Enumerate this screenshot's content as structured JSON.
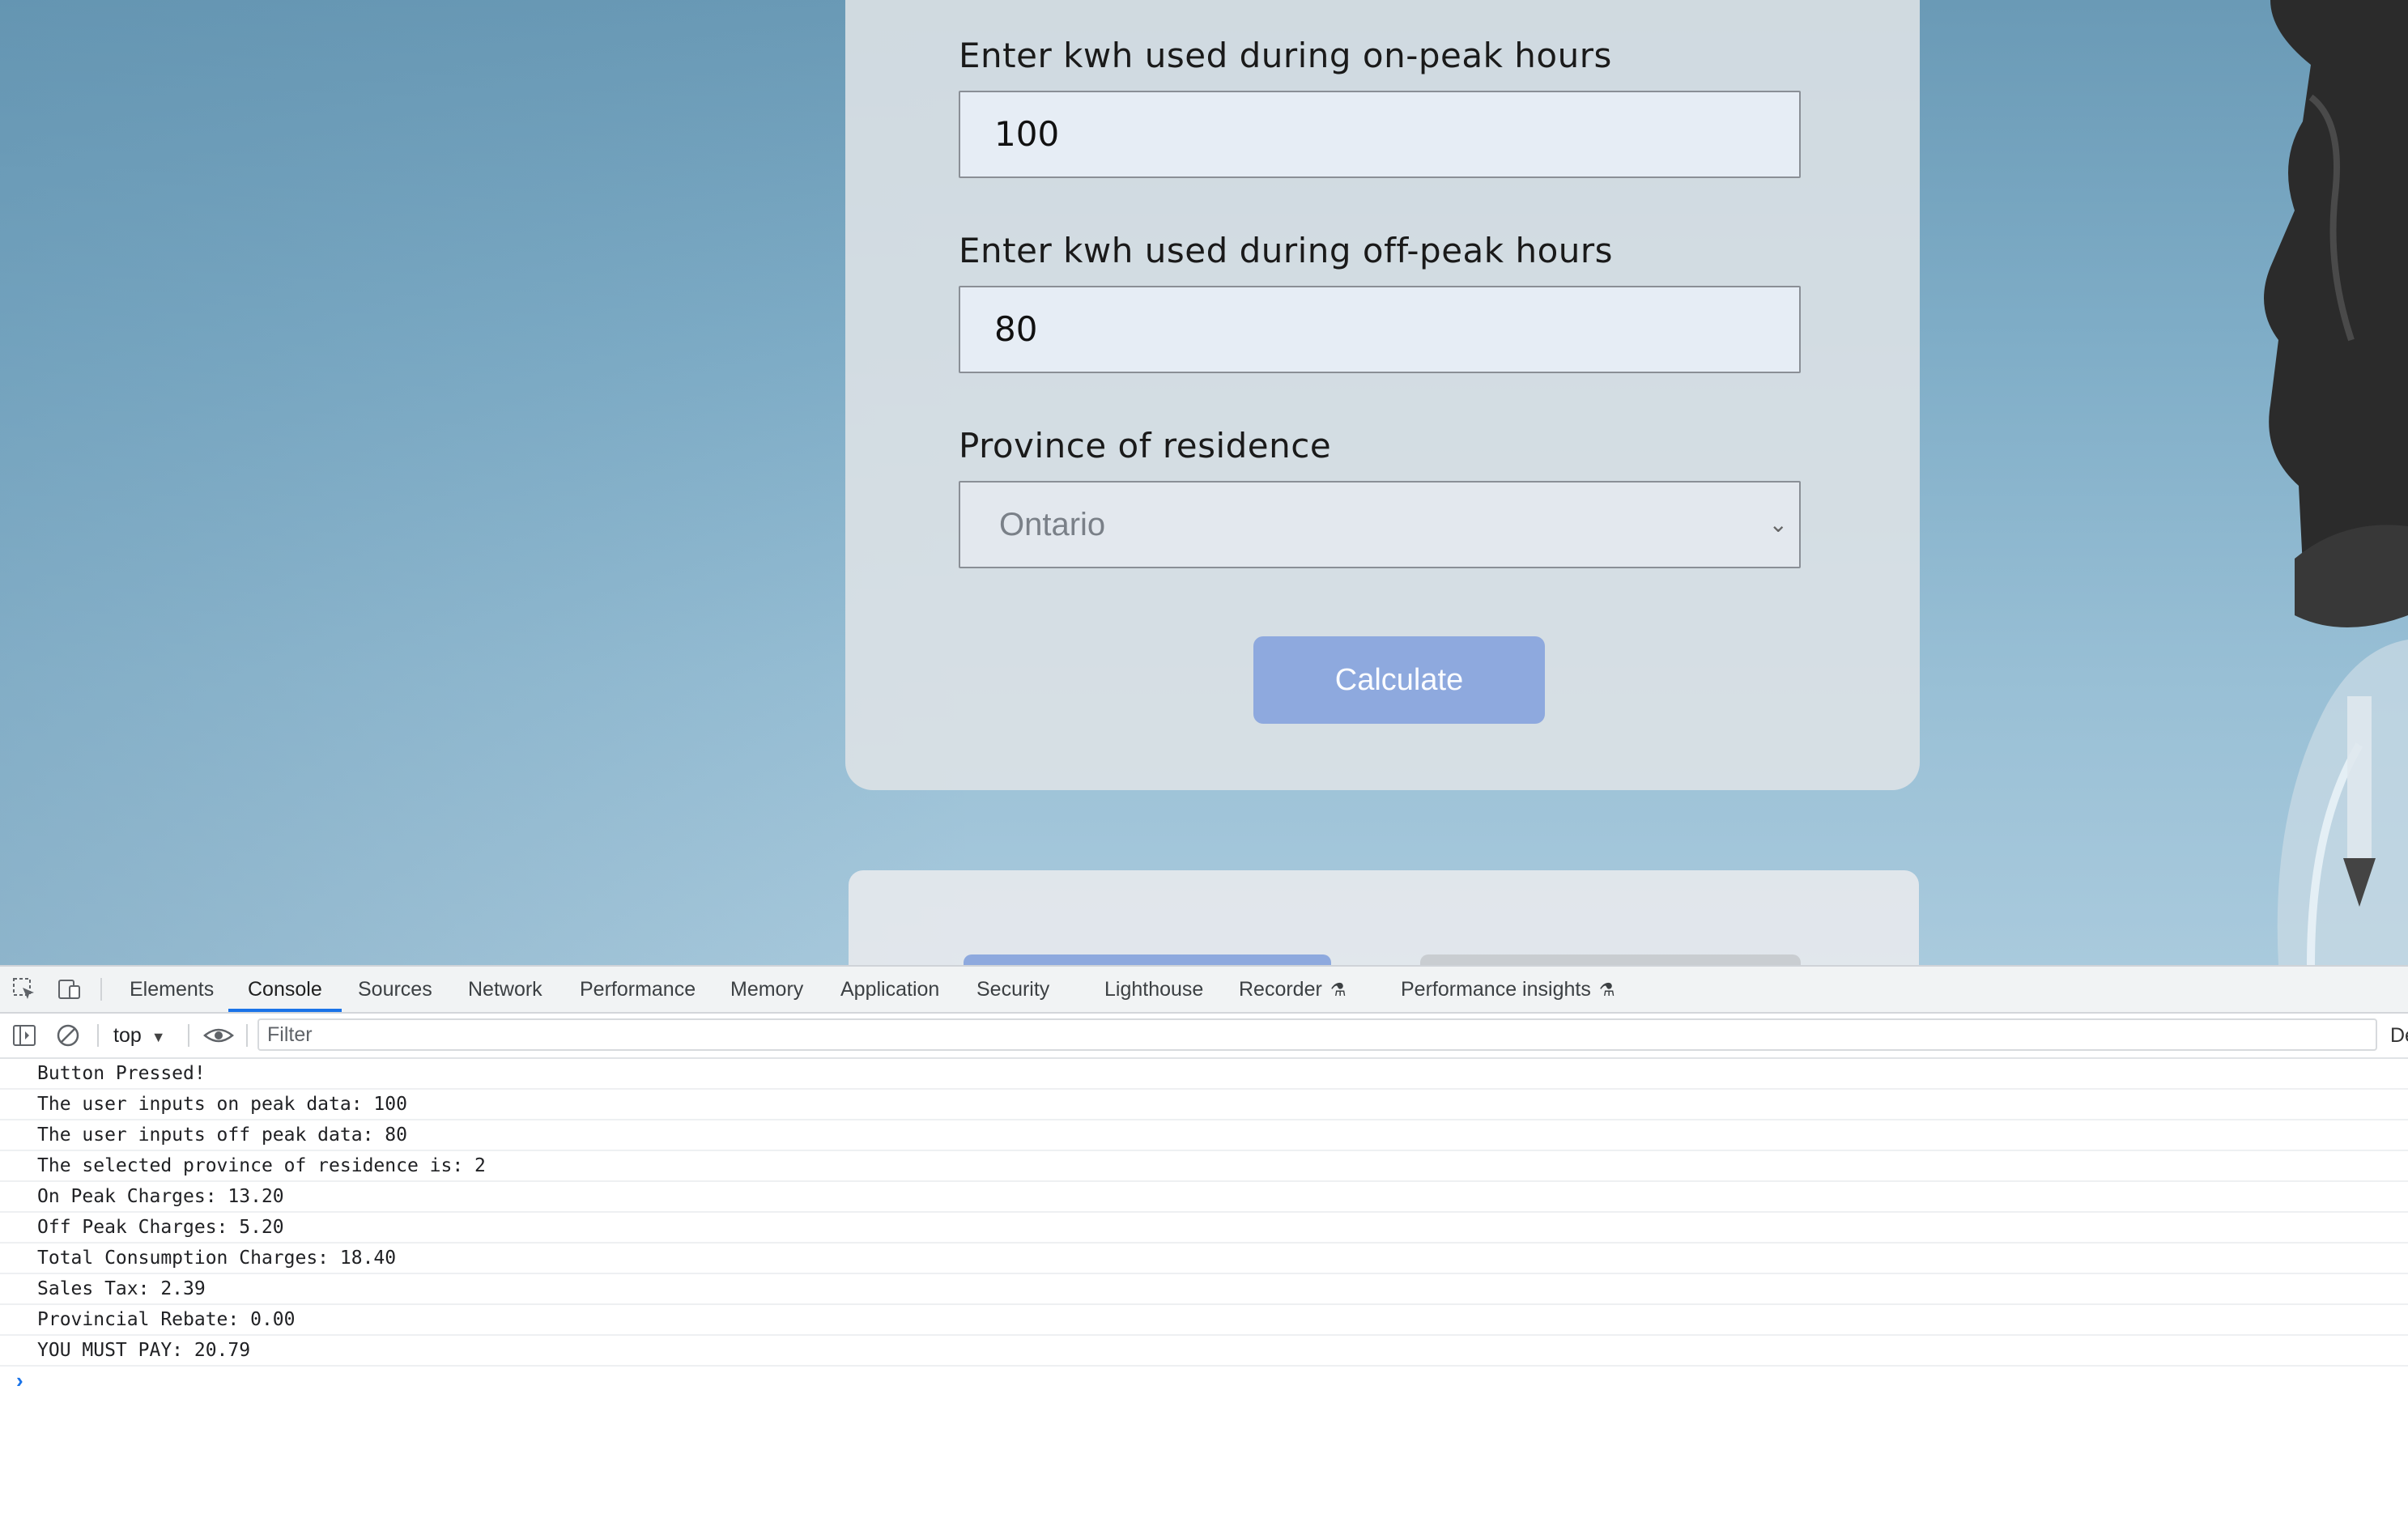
{
  "form": {
    "on_peak_label": "Enter kwh used during on-peak hours",
    "on_peak_value": "100",
    "off_peak_label": "Enter kwh used during off-peak hours",
    "off_peak_value": "80",
    "province_label": "Province of residence",
    "province_selected": "Ontario",
    "calculate_label": "Calculate"
  },
  "devtools": {
    "tabs": [
      "Elements",
      "Console",
      "Sources",
      "Network",
      "Performance",
      "Memory",
      "Application",
      "Security",
      "Lighthouse",
      "Recorder",
      "Performance insights"
    ],
    "active_tab": "Console",
    "context": "top",
    "filter_placeholder": "Filter",
    "cut_label": "De",
    "console_lines": [
      "Button Pressed!",
      "The user inputs on peak data: 100",
      "The user inputs off peak data: 80",
      "The selected province of residence is: 2",
      "On Peak Charges: 13.20",
      "Off Peak Charges: 5.20",
      "Total Consumption Charges: 18.40",
      "Sales Tax: 2.39",
      "Provincial Rebate: 0.00",
      "YOU MUST PAY: 20.79"
    ],
    "prompt_symbol": "›"
  },
  "colors": {
    "accent": "#1a73e8",
    "button": "#8ea9de"
  }
}
